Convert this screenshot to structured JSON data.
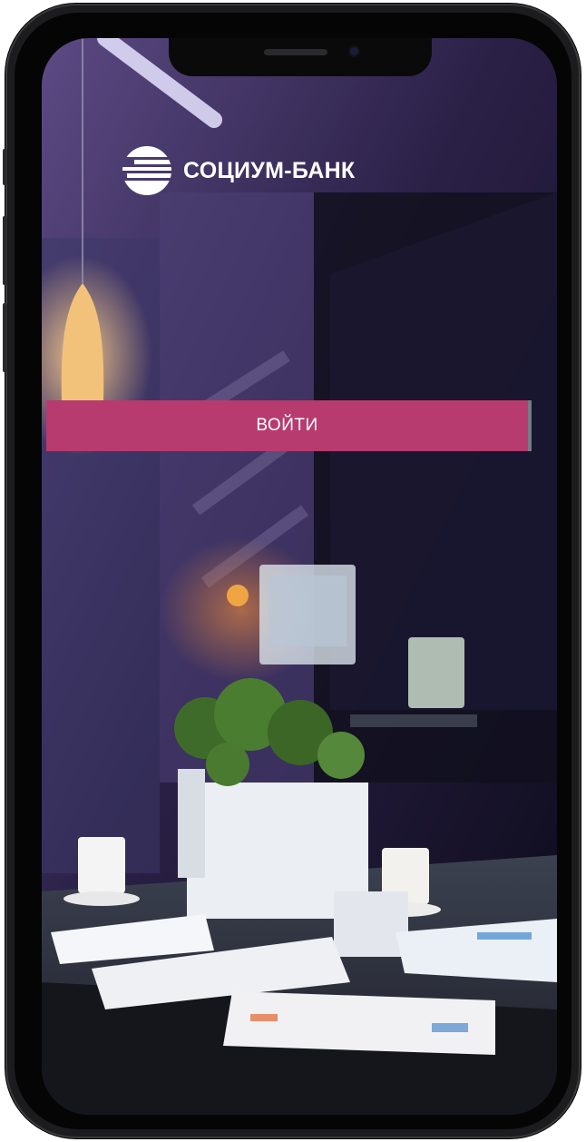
{
  "brand": {
    "name": "СОЦИУМ-БАНК"
  },
  "actions": {
    "login_label": "ВОЙТИ"
  },
  "colors": {
    "accent": "#b73b6e",
    "background": "#1b1530",
    "text": "#ffffff"
  },
  "icons": {
    "logo": "socium-bank-logo-icon"
  }
}
